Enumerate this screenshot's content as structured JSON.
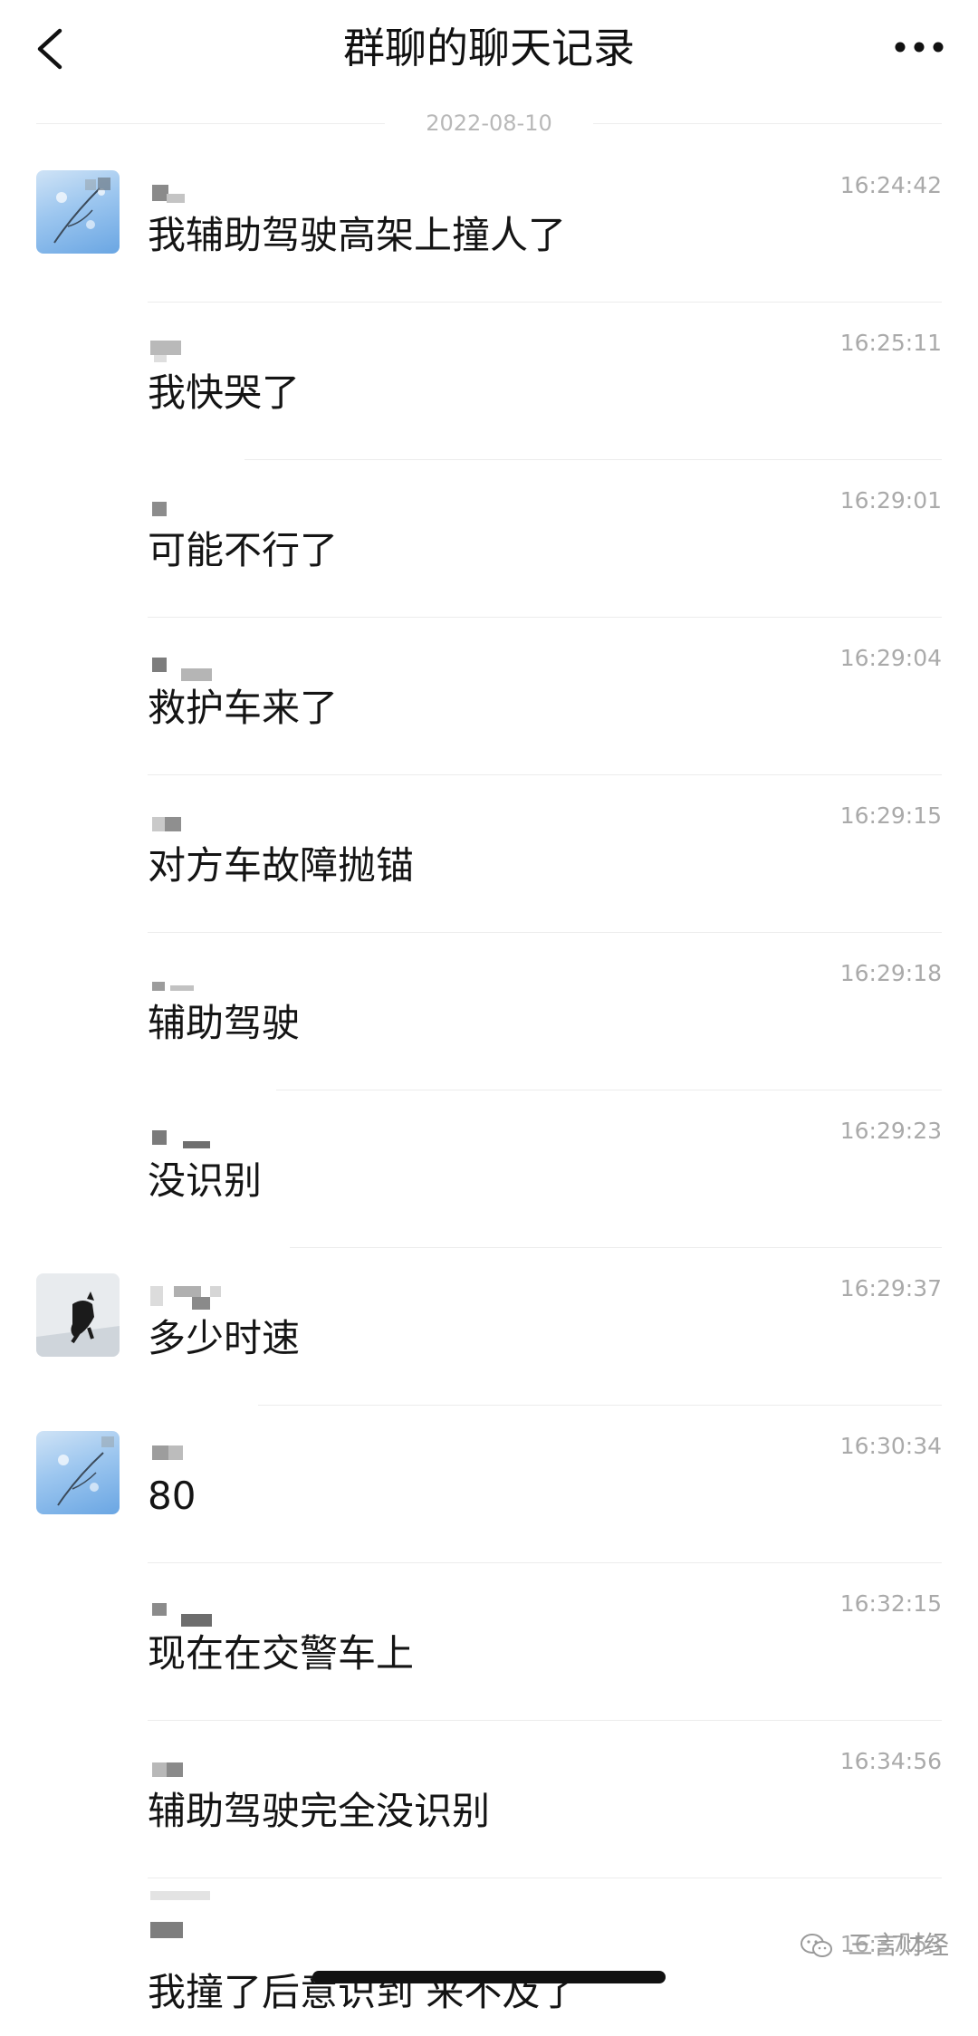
{
  "header": {
    "title": "群聊的聊天记录"
  },
  "date_separator": "2022-08-10",
  "messages": [
    {
      "time": "16:24:42",
      "text": "我辅助驾驶高架上撞人了",
      "avatar": "flower-avatar"
    },
    {
      "time": "16:25:11",
      "text": "我快哭了",
      "avatar": ""
    },
    {
      "time": "16:29:01",
      "text": "可能不行了",
      "avatar": ""
    },
    {
      "time": "16:29:04",
      "text": "救护车来了",
      "avatar": ""
    },
    {
      "time": "16:29:15",
      "text": "对方车故障抛锚",
      "avatar": ""
    },
    {
      "time": "16:29:18",
      "text": "辅助驾驶",
      "avatar": ""
    },
    {
      "time": "16:29:23",
      "text": "没识别",
      "avatar": ""
    },
    {
      "time": "16:29:37",
      "text": "多少时速",
      "avatar": "cat-avatar"
    },
    {
      "time": "16:30:34",
      "text": "80",
      "avatar": "flower-avatar"
    },
    {
      "time": "16:32:15",
      "text": "现在在交警车上",
      "avatar": ""
    },
    {
      "time": "16:34:56",
      "text": "辅助驾驶完全没识别",
      "avatar": ""
    },
    {
      "time": "16:37:53",
      "text": "我撞了后意识到 来不及了",
      "avatar": ""
    }
  ],
  "watermark": {
    "text": "三言财经",
    "icon": "wechat-icon"
  },
  "colors": {
    "background": "#ffffff",
    "text": "#141414",
    "time": "#aaaaaa",
    "divider": "#ececec"
  }
}
